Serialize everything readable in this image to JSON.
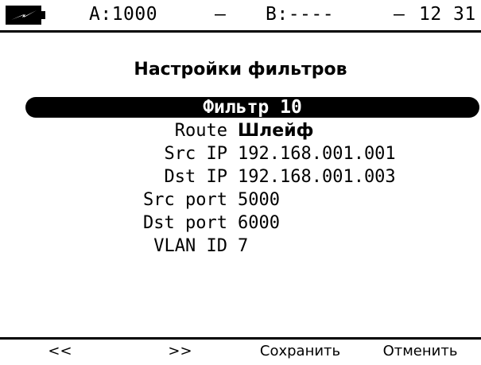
{
  "statusbar": {
    "battery_icon": "battery-charging-icon",
    "channel_a": "A:1000",
    "sep1": "–",
    "channel_b": "B:----",
    "sep2": "–",
    "time": "12 31"
  },
  "screen_title": "Настройки фильтров",
  "filter": {
    "name": "Фильтр 10"
  },
  "fields": [
    {
      "label": "Route",
      "value": "Шлейф"
    },
    {
      "label": "Src IP",
      "value": "192.168.001.001"
    },
    {
      "label": "Dst IP",
      "value": "192.168.001.003"
    },
    {
      "label": "Src port",
      "value": "5000"
    },
    {
      "label": "Dst port",
      "value": "6000"
    },
    {
      "label": "VLAN ID",
      "value": "7"
    }
  ],
  "softkeys": {
    "prev": "<<",
    "next": ">>",
    "save": "Сохранить",
    "cancel": "Отменить"
  }
}
